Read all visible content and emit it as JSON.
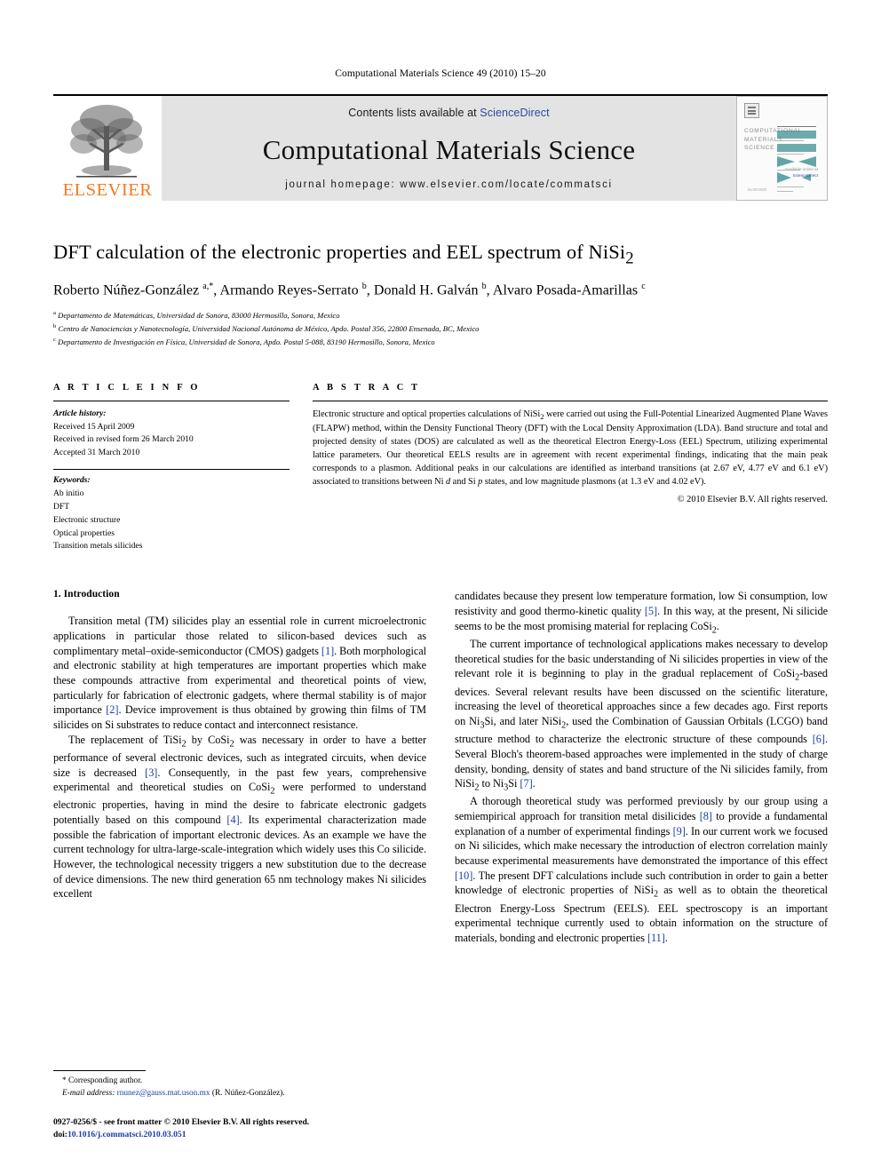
{
  "running_head": "Computational Materials Science 49 (2010) 15–20",
  "masthead": {
    "publisher_name": "ELSEVIER",
    "contents_prefix": "Contents lists available at ",
    "contents_link": "ScienceDirect",
    "journal_title": "Computational Materials Science",
    "homepage": "journal homepage: www.elsevier.com/locate/commatsci",
    "cover": {
      "line1": "COMPUTATIONAL",
      "line2": "MATERIALS",
      "line3": "SCIENCE",
      "footer_prefix": "Available online at",
      "footer_link": "ScienceDirect",
      "bottom": "ELSEVIER"
    }
  },
  "article": {
    "title": "DFT calculation of the electronic properties and EEL spectrum of NiSi",
    "title_sub": "2",
    "authors": "Roberto Núñez-González a,*, Armando Reyes-Serrato b, Donald H. Galván b, Alvaro Posada-Amarillas c",
    "affiliations": [
      "a Departamento de Matemáticas, Universidad de Sonora, 83000 Hermosillo, Sonora, Mexico",
      "b Centro de Nanociencias y Nanotecnología, Universidad Nacional Autónoma de México, Apdo. Postal 356, 22800 Ensenada, BC, Mexico",
      "c Departamento de Investigación en Física, Universidad de Sonora, Apdo. Postal 5-088, 83190 Hermosillo, Sonora, Mexico"
    ]
  },
  "info": {
    "heading": "A R T I C L E    I N F O",
    "history_label": "Article history:",
    "history": [
      "Received 15 April 2009",
      "Received in revised form 26 March 2010",
      "Accepted 31 March 2010"
    ],
    "keywords_label": "Keywords:",
    "keywords": [
      "Ab initio",
      "DFT",
      "Electronic structure",
      "Optical properties",
      "Transition metals silicides"
    ]
  },
  "abstract": {
    "heading": "A B S T R A C T",
    "text": "Electronic structure and optical properties calculations of NiSi2 were carried out using the Full-Potential Linearized Augmented Plane Waves (FLAPW) method, within the Density Functional Theory (DFT) with the Local Density Approximation (LDA). Band structure and total and projected density of states (DOS) are calculated as well as the theoretical Electron Energy-Loss (EEL) Spectrum, utilizing experimental lattice parameters. Our theoretical EELS results are in agreement with recent experimental findings, indicating that the main peak corresponds to a plasmon. Additional peaks in our calculations are identified as interband transitions (at 2.67 eV, 4.77 eV and 6.1 eV) associated to transitions between Ni d and Si p states, and low magnitude plasmons (at 1.3 eV and 4.02 eV).",
    "copyright": "© 2010 Elsevier B.V. All rights reserved."
  },
  "body": {
    "section_title": "1. Introduction",
    "left_paragraphs": [
      "Transition metal (TM) silicides play an essential role in current microelectronic applications in particular those related to silicon-based devices such as complimentary metal–oxide-semiconductor (CMOS) gadgets [1]. Both morphological and electronic stability at high temperatures are important properties which make these compounds attractive from experimental and theoretical points of view, particularly for fabrication of electronic gadgets, where thermal stability is of major importance [2]. Device improvement is thus obtained by growing thin films of TM silicides on Si substrates to reduce contact and interconnect resistance.",
      "The replacement of TiSi2 by CoSi2 was necessary in order to have a better performance of several electronic devices, such as integrated circuits, when device size is decreased [3]. Consequently, in the past few years, comprehensive experimental and theoretical studies on CoSi2 were performed to understand electronic properties, having in mind the desire to fabricate electronic gadgets potentially based on this compound [4]. Its experimental characterization made possible the fabrication of important electronic devices. As an example we have the current technology for ultra-large-scale-integration which widely uses this Co silicide. However, the technological necessity triggers a new substitution due to the decrease of device dimensions. The new third generation 65 nm technology makes Ni silicides excellent"
    ],
    "right_paragraphs": [
      "candidates because they present low temperature formation, low Si consumption, low resistivity and good thermo-kinetic quality [5]. In this way, at the present, Ni silicide seems to be the most promising material for replacing CoSi2.",
      "The current importance of technological applications makes necessary to develop theoretical studies for the basic understanding of Ni silicides properties in view of the relevant role it is beginning to play in the gradual replacement of CoSi2-based devices. Several relevant results have been discussed on the scientific literature, increasing the level of theoretical approaches since a few decades ago. First reports on Ni3Si, and later NiSi2, used the Combination of Gaussian Orbitals (LCGO) band structure method to characterize the electronic structure of these compounds [6]. Several Bloch's theorem-based approaches were implemented in the study of charge density, bonding, density of states and band structure of the Ni silicides family, from NiSi2 to Ni3Si [7].",
      "A thorough theoretical study was performed previously by our group using a semiempirical approach for transition metal disilicides [8] to provide a fundamental explanation of a number of experimental findings [9]. In our current work we focused on Ni silicides, which make necessary the introduction of electron correlation mainly because experimental measurements have demonstrated the importance of this effect [10]. The present DFT calculations include such contribution in order to gain a better knowledge of electronic properties of NiSi2 as well as to obtain the theoretical Electron Energy-Loss Spectrum (EELS). EEL spectroscopy is an important experimental technique currently used to obtain information on the structure of materials, bonding and electronic properties [11]."
    ]
  },
  "footnotes": {
    "corresponding": "* Corresponding author.",
    "email_label": "E-mail address:",
    "email": "rnunez@gauss.mat.uson.mx",
    "email_owner": "(R. Núñez-González).",
    "issn": "0927-0256/$ - see front matter © 2010 Elsevier B.V. All rights reserved.",
    "doi_label": "doi:",
    "doi": "10.1016/j.commatsci.2010.03.051"
  },
  "colors": {
    "link": "#2c49a0",
    "citation": "#1c3fa0",
    "elsevier_orange": "#f47920",
    "masthead_gray": "#e3e3e3"
  }
}
